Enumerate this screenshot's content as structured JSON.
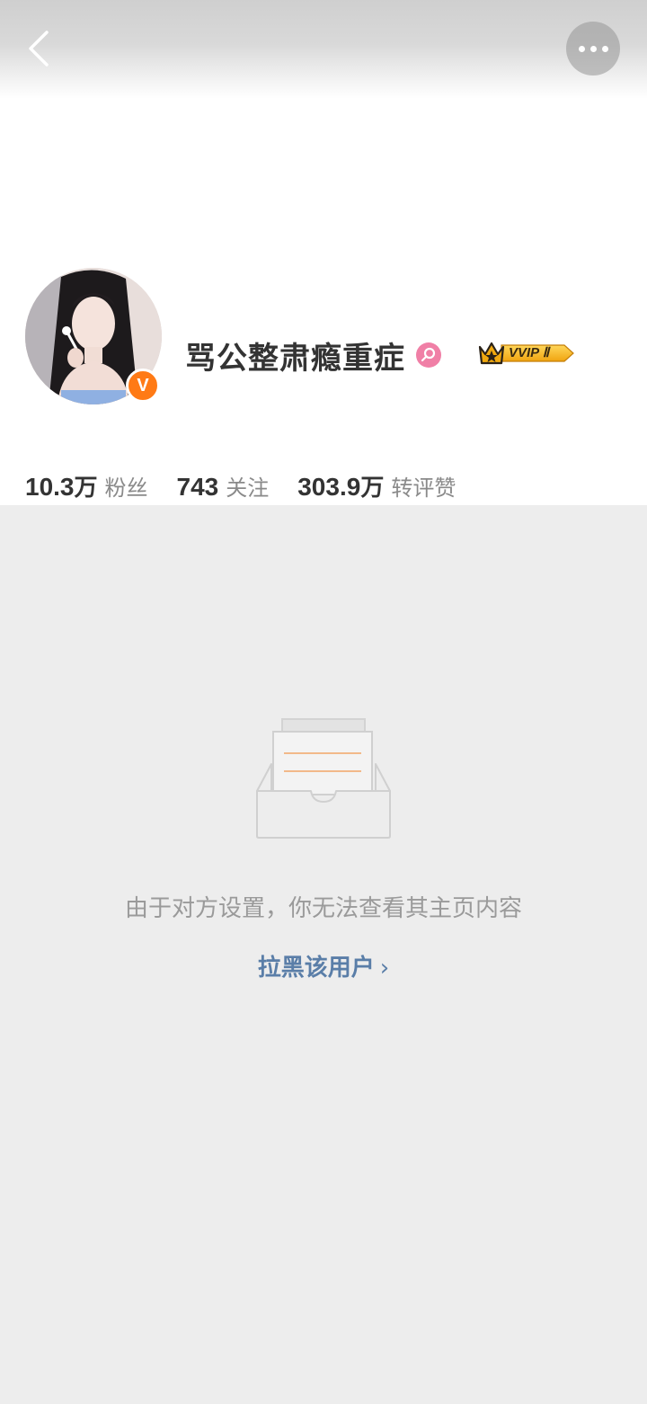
{
  "header": {
    "back_icon": "chevron-left-icon",
    "more_icon": "more-dots-icon"
  },
  "profile": {
    "name": "骂公整肃瘾重症",
    "avatar": "profile-photo",
    "verified_badge": "V",
    "verified_color": "#ff7a15",
    "gender_icon": "female-icon",
    "gender_color": "#f07fa6",
    "vip_badge_text": "VVIP Ⅱ",
    "vip_color": "#f5b21b"
  },
  "stats": [
    {
      "number": "10.3",
      "unit": "万",
      "label": "粉丝"
    },
    {
      "number": "743",
      "unit": "",
      "label": "关注"
    },
    {
      "number": "303.9",
      "unit": "万",
      "label": "转评赞"
    }
  ],
  "empty_state": {
    "icon": "empty-inbox-icon",
    "message": "由于对方设置，你无法查看其主页内容",
    "action_label": "拉黑该用户",
    "action_color": "#5a7ea8"
  }
}
